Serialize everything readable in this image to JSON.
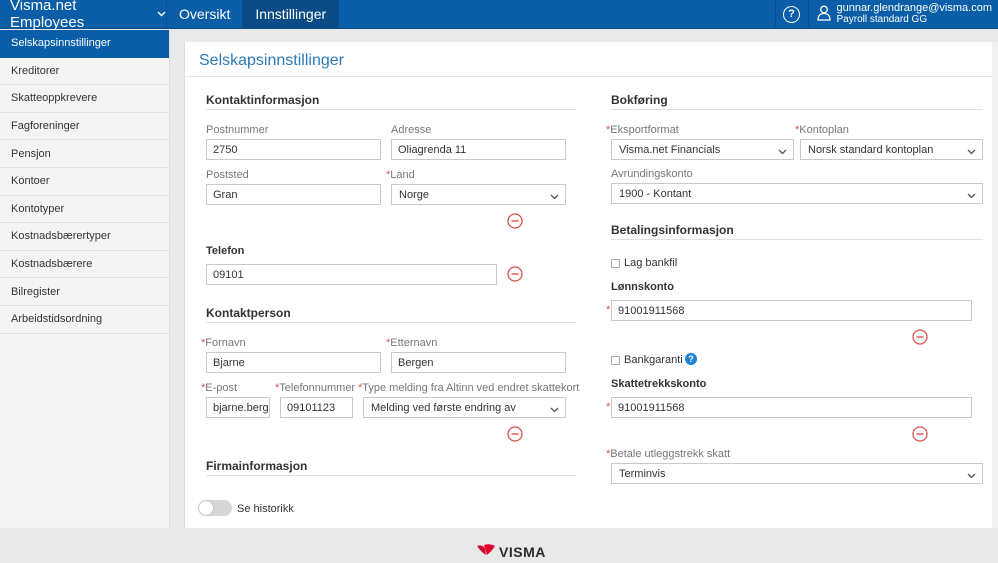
{
  "app": {
    "title": "Visma.net Employees"
  },
  "nav": {
    "tabs": [
      {
        "label": "Oversikt"
      },
      {
        "label": "Innstillinger"
      }
    ]
  },
  "help": {
    "glyph": "?"
  },
  "user": {
    "email": "gunnar.glendrange@visma.com",
    "role": "Payroll standard GG"
  },
  "sidebar": {
    "items": [
      {
        "label": "Selskapsinnstillinger"
      },
      {
        "label": "Kreditorer"
      },
      {
        "label": "Skatteoppkrevere"
      },
      {
        "label": "Fagforeninger"
      },
      {
        "label": "Pensjon"
      },
      {
        "label": "Kontoer"
      },
      {
        "label": "Kontotyper"
      },
      {
        "label": "Kostnadsbærertyper"
      },
      {
        "label": "Kostnadsbærere"
      },
      {
        "label": "Bilregister"
      },
      {
        "label": "Arbeidstidsordning"
      }
    ]
  },
  "page": {
    "title": "Selskapsinnstillinger"
  },
  "contact": {
    "title": "Kontaktinformasjon",
    "postnummer_label": "Postnummer",
    "postnummer": "2750",
    "adresse_label": "Adresse",
    "adresse": "Oliagrenda 11",
    "poststed_label": "Poststed",
    "poststed": "Gran",
    "land_label": "Land",
    "land": "Norge",
    "telefon_label": "Telefon",
    "telefon": "09101"
  },
  "contact_person": {
    "title": "Kontaktperson",
    "fornavn_label": "Fornavn",
    "fornavn": "Bjarne",
    "etternavn_label": "Etternavn",
    "etternavn": "Bergen",
    "epost_label": "E-post",
    "epost": "bjarne.bergen@",
    "telefonnummer_label": "Telefonnummer",
    "telefonnummer": "09101123",
    "melding_label": "Type melding fra Altinn ved endret skattekort",
    "melding": "Melding ved første endring av"
  },
  "company": {
    "title": "Firmainformasjon"
  },
  "bookkeeping": {
    "title": "Bokføring",
    "eksportformat_label": "Eksportformat",
    "eksportformat": "Visma.net Financials",
    "kontoplan_label": "Kontoplan",
    "kontoplan": "Norsk standard kontoplan",
    "avrunding_label": "Avrundingskonto",
    "avrunding": "1900 - Kontant"
  },
  "payment": {
    "title": "Betalingsinformasjon",
    "lag_bankfil_label": "Lag bankfil",
    "lonnskonto_label": "Lønnskonto",
    "lonnskonto": "91001911568",
    "bankgaranti_label": "Bankgaranti",
    "skattetrekk_label": "Skattetrekkskonto",
    "skattetrekk": "91001911568",
    "utleggstrekk_label": "Betale utleggstrekk skatt",
    "utleggstrekk": "Terminvis"
  },
  "history": {
    "label": "Se historikk"
  },
  "footer": {
    "logo_text": "VISMA"
  },
  "colors": {
    "brand": "#0a5ea8",
    "required": "#d9534f",
    "link": "#2a7ab8"
  }
}
